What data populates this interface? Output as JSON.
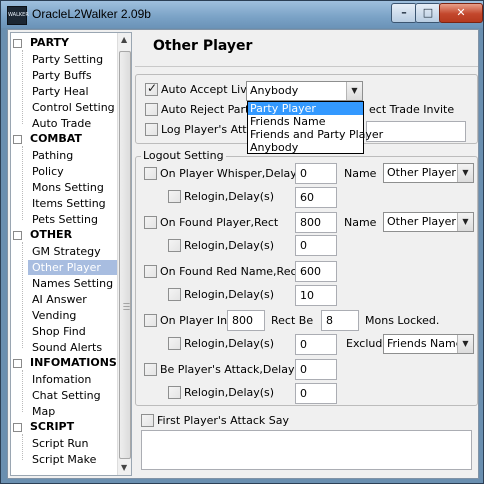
{
  "window": {
    "title": "OracleL2Walker 2.09b",
    "icon_text": "WALKER",
    "icon": "app-logo-icon",
    "controls": {
      "minimize_icon": "minimize-icon",
      "maximize_icon": "maximize-icon",
      "close_icon": "close-icon"
    },
    "accent": "#a8bde0"
  },
  "sidebar": {
    "sections": [
      {
        "label": "PARTY",
        "items": [
          "Party Setting",
          "Party Buffs",
          "Party Heal",
          "Control Setting",
          "Auto Trade"
        ]
      },
      {
        "label": "COMBAT",
        "items": [
          "Pathing",
          "Policy",
          "Mons Setting",
          "Items Setting",
          "Pets Setting"
        ]
      },
      {
        "label": "OTHER",
        "items": [
          "GM Strategy",
          "Other Player",
          "Names Setting",
          "AI Answer",
          "Vending",
          "Shop Find",
          "Sound Alerts"
        ]
      },
      {
        "label": "INFOMATIONS",
        "items": [
          "Infomation",
          "Chat Setting",
          "Map"
        ]
      },
      {
        "label": "SCRIPT",
        "items": [
          "Script Run",
          "Script Make"
        ]
      }
    ],
    "selected": "Other Player"
  },
  "main": {
    "title": "Other Player",
    "top": {
      "auto_accept_live": {
        "label": "Auto Accept Live",
        "checked": true,
        "dropdown_value": "Anybody"
      },
      "auto_reject_party": {
        "label": "Auto Reject Party",
        "checked": false
      },
      "reject_trade_invite": {
        "label": "ect Trade Invite"
      },
      "players_attack": {
        "label": "Log Player's Attac",
        "checked": false
      },
      "dropdown_options": [
        "Party Player",
        "Friends Name",
        "Friends and Party Player",
        "Anybody"
      ],
      "dropdown_highlighted": "Party Player"
    },
    "logout": {
      "title": "Logout Setting",
      "whisper": {
        "label": "On Player Whisper,Delay(s)",
        "delay": "0",
        "name_label": "Name",
        "name_value": "Other Player N",
        "relogin_label": "Relogin,Delay(s)",
        "relogin_delay": "60"
      },
      "found_player": {
        "label": "On Found Player,Rect",
        "rect": "800",
        "name_label": "Name",
        "name_value": "Other Player N",
        "relogin_label": "Relogin,Delay(s)",
        "relogin_delay": "0"
      },
      "found_red": {
        "label": "On Found Red Name,Rect",
        "rect": "600",
        "relogin_label": "Relogin,Delay(s)",
        "relogin_delay": "10"
      },
      "player_in": {
        "label": "On Player In",
        "rect": "800",
        "rect_be_label": "Rect Be",
        "mons": "8",
        "mons_label": "Mons Locked.",
        "relogin_label": "Relogin,Delay(s)",
        "relogin_delay": "0",
        "exclude_label": "Exclude",
        "exclude_value": "Friends NameL"
      },
      "be_attack": {
        "label": "Be Player's Attack,Delay(s)",
        "delay": "0",
        "relogin_label": "Relogin,Delay(s)",
        "relogin_delay": "0"
      }
    },
    "first_attack_say": {
      "label": "First Player's Attack Say",
      "checked": false,
      "text": ""
    }
  }
}
